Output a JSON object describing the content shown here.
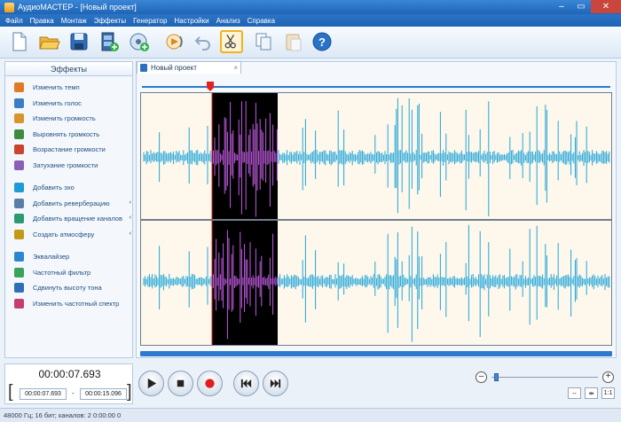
{
  "window": {
    "title": "АудиоМАСТЕР - [Новый проект]"
  },
  "menu": [
    "Файл",
    "Правка",
    "Монтаж",
    "Эффекты",
    "Генератор",
    "Настройки",
    "Анализ",
    "Справка"
  ],
  "toolbar": {
    "buttons": [
      "new-file-icon",
      "open-folder-icon",
      "save-disk-icon",
      "add-video-icon",
      "add-audio-icon",
      "playback-icon",
      "undo-icon",
      "cut-icon",
      "copy-icon",
      "paste-icon",
      "help-icon"
    ],
    "active": "cut-icon"
  },
  "effects_panel": {
    "title": "Эффекты",
    "items": [
      {
        "label": "Изменить темп",
        "icon": "tempo-icon",
        "arrow": ""
      },
      {
        "label": "Изменить голос",
        "icon": "voice-icon",
        "arrow": ""
      },
      {
        "label": "Изменить громкость",
        "icon": "volume-icon",
        "arrow": ""
      },
      {
        "label": "Выровнять громкость",
        "icon": "normalize-icon",
        "arrow": ""
      },
      {
        "label": "Возрастание громкости",
        "icon": "fade-in-icon",
        "arrow": ""
      },
      {
        "label": "Затухание громкости",
        "icon": "fade-out-icon",
        "arrow": ""
      },
      {
        "label": "Добавить эхо",
        "icon": "echo-icon",
        "arrow": ""
      },
      {
        "label": "Добавить реверберацию",
        "icon": "reverb-icon",
        "arrow": "‹"
      },
      {
        "label": "Добавить вращение каналов",
        "icon": "channel-rotate-icon",
        "arrow": "‹"
      },
      {
        "label": "Создать атмосферу",
        "icon": "atmosphere-icon",
        "arrow": "‹"
      },
      {
        "label": "Эквалайзер",
        "icon": "equalizer-icon",
        "arrow": ""
      },
      {
        "label": "Частотный фильтр",
        "icon": "frequency-filter-icon",
        "arrow": ""
      },
      {
        "label": "Сдвинуть высоту тона",
        "icon": "pitch-shift-icon",
        "arrow": ""
      },
      {
        "label": "Изменить частотный спектр",
        "icon": "spectrum-icon",
        "arrow": ""
      }
    ]
  },
  "document": {
    "tab_label": "Новый проект",
    "close": "×"
  },
  "playback": {
    "current_time": "00:00:07.693",
    "selection_start": "00:00:07.693",
    "selection_end": "00:00:15.096",
    "dash": "-"
  },
  "zoom": {
    "minus": "–",
    "plus": "+",
    "level": 0.03
  },
  "view_buttons": [
    "↔",
    "⇹",
    "1:1"
  ],
  "status": "48000 Гц; 16 бит; каналов: 2   0:00:00 0",
  "colors": {
    "waveform": "#22a6d9",
    "selection_bg": "#000000",
    "selection_wave": "#c05ce0",
    "wave_bg": "#fdf7ec",
    "playhead": "#e52222",
    "accent": "#1f65b6"
  }
}
